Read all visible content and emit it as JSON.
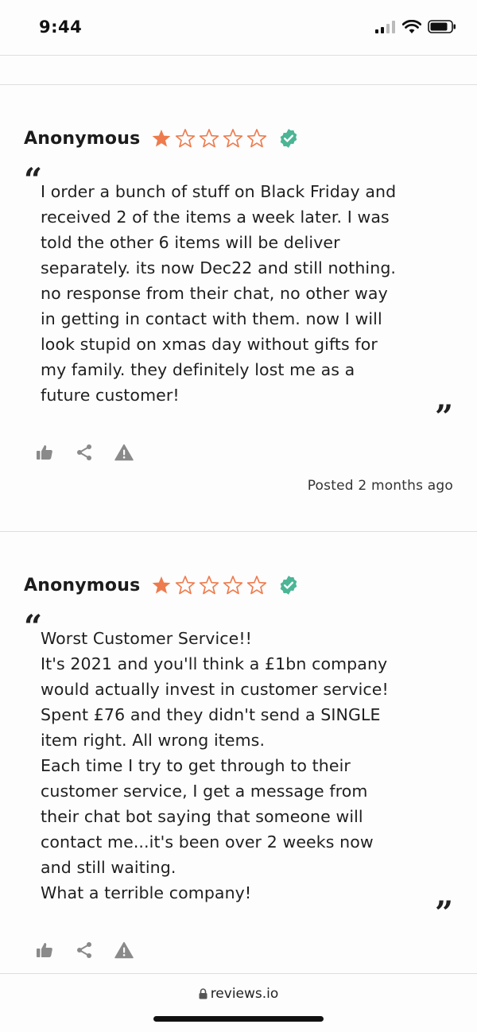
{
  "status_bar": {
    "time": "9:44"
  },
  "reviews": [
    {
      "author": "Anonymous",
      "rating": 1,
      "max_rating": 5,
      "verified": true,
      "body": "I order a bunch of stuff on Black Friday and\nreceived 2 of the items a week later. I was\ntold the other 6 items will be deliver\nseparately. its now Dec22 and still nothing.\nno response from their chat, no other way\nin getting in contact with them. now I will\nlook stupid on xmas day without gifts for\nmy family. they definitely lost me as a\nfuture customer!",
      "posted": "Posted 2 months ago"
    },
    {
      "author": "Anonymous",
      "rating": 1,
      "max_rating": 5,
      "verified": true,
      "body": "Worst Customer Service!!\nIt's 2021 and you'll think a £1bn company\nwould actually invest in customer service!\nSpent £76 and they didn't send a SINGLE\nitem right. All wrong items.\nEach time I try to get through to their\ncustomer service, I get a message from\ntheir chat bot saying that someone will\ncontact me...it's been over 2 weeks now\nand still waiting.\nWhat a terrible company!"
    }
  ],
  "quotes": {
    "open": "“",
    "close": "”"
  },
  "browser": {
    "url": "reviews.io"
  },
  "colors": {
    "star": "#ee7b4d",
    "verified": "#4bb596",
    "icon_gray": "#8a8a8a"
  },
  "icons": [
    "thumbs-up-icon",
    "share-icon",
    "report-icon",
    "lock-icon",
    "signal-icon",
    "wifi-icon",
    "battery-icon"
  ]
}
